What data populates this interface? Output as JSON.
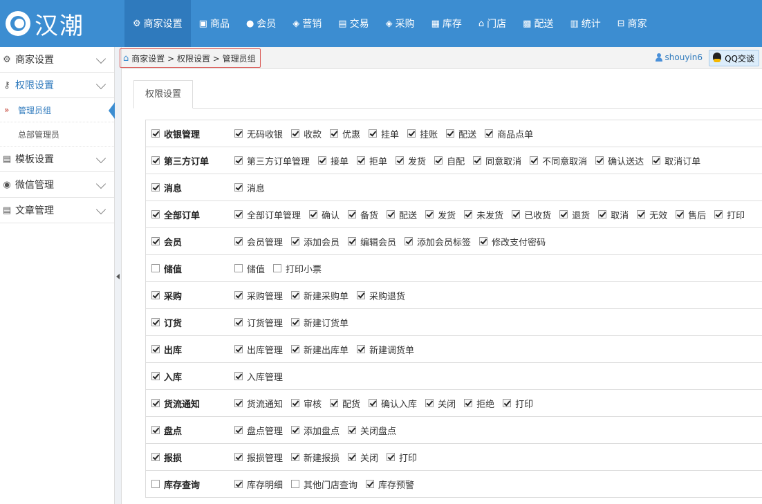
{
  "logo": {
    "text": "汉潮"
  },
  "topnav": [
    {
      "label": "商家设置",
      "icon": "gear-icon",
      "glyph": "⚙",
      "active": true
    },
    {
      "label": "商品",
      "icon": "box-icon",
      "glyph": "▣",
      "active": false
    },
    {
      "label": "会员",
      "icon": "user-icon",
      "glyph": "●",
      "active": false
    },
    {
      "label": "营销",
      "icon": "megaphone-icon",
      "glyph": "◈",
      "active": false
    },
    {
      "label": "交易",
      "icon": "clipboard-icon",
      "glyph": "▤",
      "active": false
    },
    {
      "label": "采购",
      "icon": "cart-icon",
      "glyph": "◈",
      "active": false
    },
    {
      "label": "库存",
      "icon": "warehouse-icon",
      "glyph": "▦",
      "active": false
    },
    {
      "label": "门店",
      "icon": "home-icon",
      "glyph": "⌂",
      "active": false
    },
    {
      "label": "配送",
      "icon": "truck-icon",
      "glyph": "▩",
      "active": false
    },
    {
      "label": "统计",
      "icon": "bar-chart-icon",
      "glyph": "▥",
      "active": false
    },
    {
      "label": "商家",
      "icon": "store-icon",
      "glyph": "⊟",
      "active": false
    }
  ],
  "sidebar": {
    "groups": [
      {
        "label": "商家设置",
        "icon": "gear-icon",
        "glyph": "⚙",
        "open": false,
        "items": []
      },
      {
        "label": "权限设置",
        "icon": "key-icon",
        "glyph": "⚷",
        "open": true,
        "items": [
          {
            "label": "管理员组",
            "active": true
          },
          {
            "label": "总部管理员",
            "active": false
          }
        ]
      },
      {
        "label": "模板设置",
        "icon": "template-icon",
        "glyph": "▤",
        "open": false,
        "items": []
      },
      {
        "label": "微信管理",
        "icon": "wechat-icon",
        "glyph": "◉",
        "open": false,
        "items": []
      },
      {
        "label": "文章管理",
        "icon": "article-icon",
        "glyph": "▤",
        "open": false,
        "items": []
      }
    ]
  },
  "breadcrumb": "商家设置 > 权限设置 > 管理员组",
  "user": {
    "name": "shouyin6"
  },
  "qq_button": "QQ交谈",
  "tab": "权限设置",
  "permissions": [
    {
      "group": "收银管理",
      "checked": true,
      "items": [
        {
          "label": "无码收银",
          "checked": true
        },
        {
          "label": "收款",
          "checked": true
        },
        {
          "label": "优惠",
          "checked": true
        },
        {
          "label": "挂单",
          "checked": true
        },
        {
          "label": "挂账",
          "checked": true
        },
        {
          "label": "配送",
          "checked": true
        },
        {
          "label": "商品点单",
          "checked": true
        }
      ]
    },
    {
      "group": "第三方订单",
      "checked": true,
      "items": [
        {
          "label": "第三方订单管理",
          "checked": true
        },
        {
          "label": "接单",
          "checked": true
        },
        {
          "label": "拒单",
          "checked": true
        },
        {
          "label": "发货",
          "checked": true
        },
        {
          "label": "自配",
          "checked": true
        },
        {
          "label": "同意取消",
          "checked": true
        },
        {
          "label": "不同意取消",
          "checked": true
        },
        {
          "label": "确认送达",
          "checked": true
        },
        {
          "label": "取消订单",
          "checked": true
        }
      ]
    },
    {
      "group": "消息",
      "checked": true,
      "items": [
        {
          "label": "消息",
          "checked": true
        }
      ]
    },
    {
      "group": "全部订单",
      "checked": true,
      "items": [
        {
          "label": "全部订单管理",
          "checked": true
        },
        {
          "label": "确认",
          "checked": true
        },
        {
          "label": "备货",
          "checked": true
        },
        {
          "label": "配送",
          "checked": true
        },
        {
          "label": "发货",
          "checked": true
        },
        {
          "label": "未发货",
          "checked": true
        },
        {
          "label": "已收货",
          "checked": true
        },
        {
          "label": "退货",
          "checked": true
        },
        {
          "label": "取消",
          "checked": true
        },
        {
          "label": "无效",
          "checked": true
        },
        {
          "label": "售后",
          "checked": true
        },
        {
          "label": "打印",
          "checked": true
        }
      ]
    },
    {
      "group": "会员",
      "checked": true,
      "items": [
        {
          "label": "会员管理",
          "checked": true
        },
        {
          "label": "添加会员",
          "checked": true
        },
        {
          "label": "编辑会员",
          "checked": true
        },
        {
          "label": "添加会员标签",
          "checked": true
        },
        {
          "label": "修改支付密码",
          "checked": true
        }
      ]
    },
    {
      "group": "储值",
      "checked": false,
      "items": [
        {
          "label": "储值",
          "checked": false
        },
        {
          "label": "打印小票",
          "checked": false
        }
      ]
    },
    {
      "group": "采购",
      "checked": true,
      "items": [
        {
          "label": "采购管理",
          "checked": true
        },
        {
          "label": "新建采购单",
          "checked": true
        },
        {
          "label": "采购退货",
          "checked": true
        }
      ]
    },
    {
      "group": "订货",
      "checked": true,
      "items": [
        {
          "label": "订货管理",
          "checked": true
        },
        {
          "label": "新建订货单",
          "checked": true
        }
      ]
    },
    {
      "group": "出库",
      "checked": true,
      "items": [
        {
          "label": "出库管理",
          "checked": true
        },
        {
          "label": "新建出库单",
          "checked": true
        },
        {
          "label": "新建调货单",
          "checked": true
        }
      ]
    },
    {
      "group": "入库",
      "checked": true,
      "items": [
        {
          "label": "入库管理",
          "checked": true
        }
      ]
    },
    {
      "group": "货流通知",
      "checked": true,
      "items": [
        {
          "label": "货流通知",
          "checked": true
        },
        {
          "label": "审核",
          "checked": true
        },
        {
          "label": "配货",
          "checked": true
        },
        {
          "label": "确认入库",
          "checked": true
        },
        {
          "label": "关闭",
          "checked": true
        },
        {
          "label": "拒绝",
          "checked": true
        },
        {
          "label": "打印",
          "checked": true
        }
      ]
    },
    {
      "group": "盘点",
      "checked": true,
      "items": [
        {
          "label": "盘点管理",
          "checked": true
        },
        {
          "label": "添加盘点",
          "checked": true
        },
        {
          "label": "关闭盘点",
          "checked": true
        }
      ]
    },
    {
      "group": "报损",
      "checked": true,
      "items": [
        {
          "label": "报损管理",
          "checked": true
        },
        {
          "label": "新建报损",
          "checked": true
        },
        {
          "label": "关闭",
          "checked": true
        },
        {
          "label": "打印",
          "checked": true
        }
      ]
    },
    {
      "group": "库存查询",
      "checked": false,
      "items": [
        {
          "label": "库存明细",
          "checked": true
        },
        {
          "label": "其他门店查询",
          "checked": false
        },
        {
          "label": "库存预警",
          "checked": true
        }
      ]
    }
  ]
}
